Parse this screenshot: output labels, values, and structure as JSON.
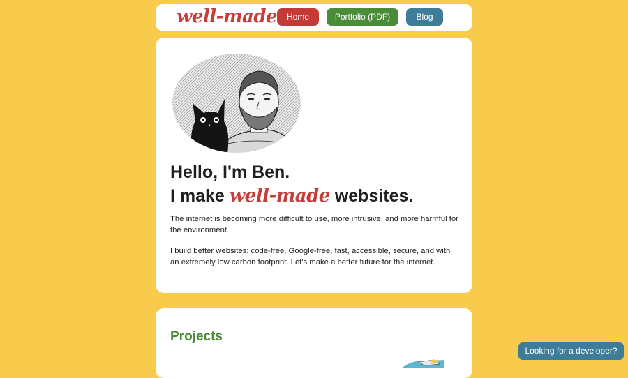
{
  "nav": {
    "logo": "well-made",
    "home": "Home",
    "portfolio": "Portfolio (PDF)",
    "blog": "Blog"
  },
  "intro": {
    "greeting": "Hello, I'm Ben.",
    "make_prefix": "I make",
    "make_brand": "well-made",
    "make_suffix": "websites.",
    "paragraph1": "The internet is becoming more difficult to use, more intrusive, and more harmful for the environment.",
    "paragraph2": "I build better websites: code-free, Google-free, fast, accessible, secure, and with an extremely low carbon footprint. Let's make a better future for the internet."
  },
  "projects": {
    "title": "Projects"
  },
  "cta": {
    "label": "Looking for a developer?"
  },
  "colors": {
    "background": "#f8cb4c",
    "brand_red": "#c43e3a",
    "green": "#4a8c38",
    "blue": "#3e7d99"
  }
}
